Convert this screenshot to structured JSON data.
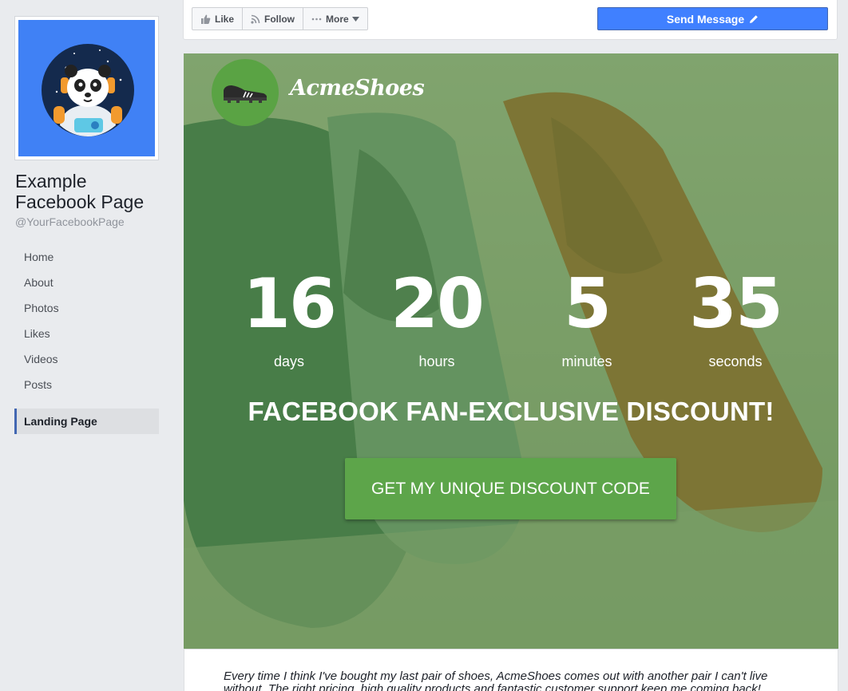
{
  "sidebar": {
    "page_name": "Example Facebook Page",
    "page_handle": "@YourFacebookPage",
    "nav": [
      "Home",
      "About",
      "Photos",
      "Likes",
      "Videos",
      "Posts"
    ],
    "active_item": "Landing Page",
    "profile_bg_color": "#4081f5"
  },
  "actions": {
    "like": "Like",
    "follow": "Follow",
    "more": "More",
    "send_message": "Send Message"
  },
  "hero": {
    "brand": "AcmeShoes",
    "countdown": [
      {
        "value": "16",
        "label": "days"
      },
      {
        "value": "20",
        "label": "hours"
      },
      {
        "value": "5",
        "label": "minutes"
      },
      {
        "value": "35",
        "label": "seconds"
      }
    ],
    "headline": "FACEBOOK FAN-EXCLUSIVE DISCOUNT!",
    "cta": "GET MY UNIQUE DISCOUNT CODE",
    "accent_color": "#5da54a"
  },
  "testimonial": {
    "text": "Every time I think I've bought my last pair of shoes, AcmeShoes comes out with another pair I can't live without. The right pricing, high quality products and fantastic customer support keep me coming back!"
  }
}
